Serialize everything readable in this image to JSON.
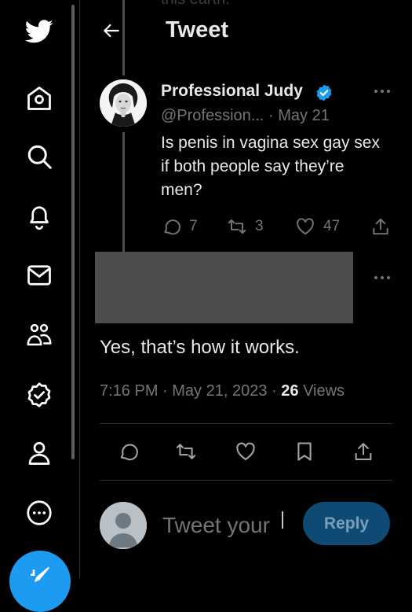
{
  "ghost_text": "this earth.",
  "header": {
    "title": "Tweet",
    "back_icon": "arrow-left-icon"
  },
  "nav": {
    "items": [
      {
        "name": "twitter-logo-icon"
      },
      {
        "name": "home-icon"
      },
      {
        "name": "search-icon"
      },
      {
        "name": "notifications-icon"
      },
      {
        "name": "messages-icon"
      },
      {
        "name": "communities-icon"
      },
      {
        "name": "verified-icon"
      },
      {
        "name": "profile-icon"
      },
      {
        "name": "more-icon"
      }
    ],
    "compose_icon": "compose-icon"
  },
  "parent_tweet": {
    "author_name": "Professional Judy",
    "handle": "@Profession...",
    "separator": " · ",
    "date": "May 21",
    "text": "Is penis in vagina sex gay sex if both people say they’re men?",
    "replies": "7",
    "retweets": "3",
    "likes": "47"
  },
  "main_tweet": {
    "text": "Yes, that’s how it works.",
    "time": "7:16 PM",
    "date": "May 21, 2023",
    "views_count": "26",
    "views_label": "Views"
  },
  "reply": {
    "placeholder": "Tweet your",
    "button_label": "Reply"
  },
  "colors": {
    "background": "#000000",
    "text_primary": "#e7e9ea",
    "text_secondary": "#71767b",
    "accent": "#1d9bf0",
    "divider": "#2f3336",
    "redaction": "#4d4d4d"
  }
}
